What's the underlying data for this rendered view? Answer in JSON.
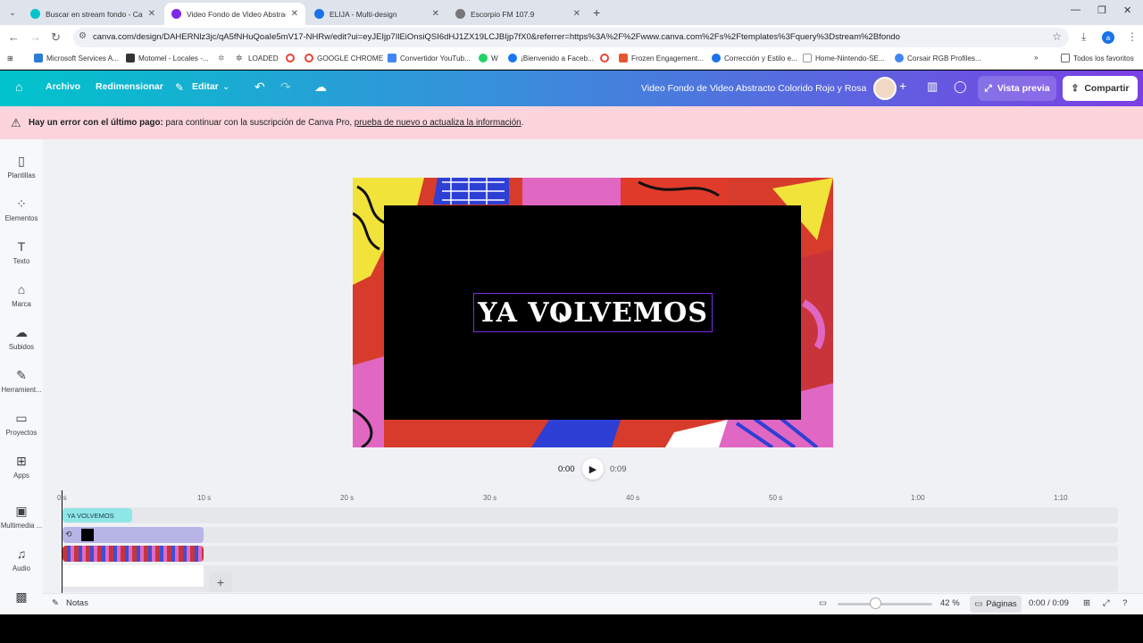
{
  "browser": {
    "tabs": [
      {
        "title": "Buscar en stream fondo - Canva",
        "color": "#00c4cc"
      },
      {
        "title": "Video Fondo de Video Abstracto",
        "color": "#7d2ae8"
      },
      {
        "title": "ELIJA - Multi-design",
        "color": "#1a73e8"
      },
      {
        "title": "Escorpio FM 107.9",
        "color": "#555555"
      }
    ],
    "new_tab": "+",
    "url": "canva.com/design/DAHERNlz3jc/qA5fNHuQoaIe5mV17-NHRw/edit?ui=eyJEIjp7IlEiOnsiQSI6dHJ1ZX19LCJBIjp7fX0&referrer=https%3A%2F%2Fwww.canva.com%2Fs%2Ftemplates%3Fquery%3Dstream%2Bfondo",
    "bookmarks": [
      {
        "label": "Microsoft Services A...",
        "color": "#2b7cd3"
      },
      {
        "label": "Motomel - Locales -...",
        "color": "#333333"
      },
      {
        "label": "",
        "color": "#888888"
      },
      {
        "label": "LOADED",
        "color": "#555555"
      },
      {
        "label": "GOOGLE CHROME",
        "color": "#ea4335"
      },
      {
        "label": "Convertidor YouTub...",
        "color": "#4285f4"
      },
      {
        "label": "W",
        "color": "#25d366"
      },
      {
        "label": "¡Bienvenido a Faceb...",
        "color": "#1877f2"
      },
      {
        "label": "",
        "color": "#ea4335"
      },
      {
        "label": "Frozen Engagement...",
        "color": "#e4572e"
      },
      {
        "label": "Corrección y Estilo e...",
        "color": "#1a73e8"
      },
      {
        "label": "Home-Nintendo-SE...",
        "color": "#ffffff"
      },
      {
        "label": "Corsair RGB Profiles...",
        "color": "#4285f4"
      }
    ],
    "favorites_label": "Todos los favoritos",
    "profile_initial": "a"
  },
  "header": {
    "archivo": "Archivo",
    "redimensionar": "Redimensionar",
    "editar": "Editar",
    "design_title": "Video Fondo de Video Abstracto Colorido Rojo y Rosa",
    "preview_label": "Vista previa",
    "share_label": "Compartir"
  },
  "error_banner": {
    "bold": "Hay un error con el último pago:",
    "text": " para continuar con la suscripción de Canva Pro, ",
    "link": "prueba de nuevo o actualiza la información",
    "end": "."
  },
  "sidebar": {
    "items": [
      {
        "label": "Plantillas",
        "icon": "layout-icon"
      },
      {
        "label": "Elementos",
        "icon": "elements-icon"
      },
      {
        "label": "Texto",
        "icon": "text-icon"
      },
      {
        "label": "Marca",
        "icon": "brand-icon"
      },
      {
        "label": "Subidos",
        "icon": "upload-icon"
      },
      {
        "label": "Herramient...",
        "icon": "draw-icon"
      },
      {
        "label": "Proyectos",
        "icon": "folder-icon"
      },
      {
        "label": "Apps",
        "icon": "apps-icon"
      },
      {
        "label": "Multimedia ...",
        "icon": "media-icon"
      },
      {
        "label": "Audio",
        "icon": "audio-icon"
      }
    ]
  },
  "canvas": {
    "headline": "YA VOLVEMOS"
  },
  "playback": {
    "current": "0:00",
    "duration": "0:09"
  },
  "timeline": {
    "ruler": [
      "0 s",
      "10 s",
      "20 s",
      "30 s",
      "40 s",
      "50 s",
      "1:00",
      "1:10"
    ],
    "text_clip": "YA VOLVEMOS"
  },
  "bottom": {
    "notes": "Notas",
    "zoom": "42 %",
    "pages": "Páginas",
    "time": "0:00 / 0:09"
  }
}
